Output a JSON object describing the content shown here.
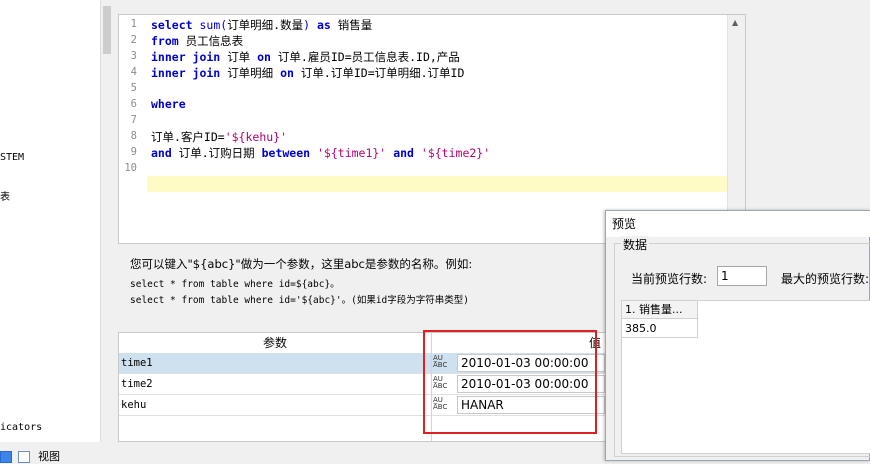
{
  "left_panel": {
    "fragment_1": "STEM",
    "fragment_2": "表",
    "fragment_3": "icators",
    "bottom_label": "视图"
  },
  "editor": {
    "line_numbers": [
      "1",
      "2",
      "3",
      "4",
      "5",
      "6",
      "7",
      "8",
      "9",
      "10"
    ],
    "lines": {
      "l1": {
        "kw1": "select",
        "fn": "sum(",
        "t1": "订单明细.数量",
        "fn2": ")",
        "kw2": "as",
        "t2": "销售量"
      },
      "l2": {
        "kw1": "from",
        "t1": "员工信息表"
      },
      "l3": {
        "kw1": "inner join",
        "t1": "订单",
        "kw2": "on",
        "t2": "订单.雇员ID=员工信息表.ID,产品"
      },
      "l4": {
        "kw1": "inner join",
        "t1": "订单明细",
        "kw2": "on",
        "t2": "订单.订单ID=订单明细.订单ID"
      },
      "l6": {
        "kw1": "where"
      },
      "l8": {
        "t1": "订单.客户ID=",
        "s1": "'${kehu}'"
      },
      "l9": {
        "kw1": "and",
        "t1": "订单.订购日期",
        "kw2": "between",
        "s1": "'${time1}'",
        "kw3": "and",
        "s2": "'${time2}'"
      }
    }
  },
  "help": {
    "line1": "您可以键入\"${abc}\"做为一个参数，这里abc是参数的名称。例如:",
    "line2": "select * from table where id=${abc}。",
    "line3": "select * from table where id='${abc}'。(如果id字段为字符串类型)"
  },
  "params": {
    "col_param": "参数",
    "col_value": "值",
    "type_icon_text": "A̲U ABC",
    "rows": [
      {
        "name": "time1",
        "value": "2010-01-03 00:00:00"
      },
      {
        "name": "time2",
        "value": "2010-01-03 00:00:00"
      },
      {
        "name": "kehu",
        "value": "HANAR"
      }
    ]
  },
  "preview": {
    "title": "预览",
    "group_label": "数据",
    "current_rows_label": "当前预览行数:",
    "current_rows_value": "1",
    "max_rows_label": "最大的预览行数:",
    "column_header": "1. 销售量...",
    "cell_value": "385.0"
  },
  "colors": {
    "highlight_red": "#e02020",
    "keyword_blue": "#0000cc",
    "string_magenta": "#b8006e",
    "current_line": "#fefcc4",
    "selected_row": "#cfe0ee"
  }
}
